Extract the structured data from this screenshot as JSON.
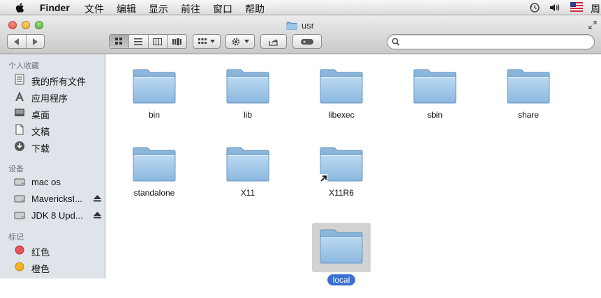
{
  "menubar": {
    "app_name": "Finder",
    "items": [
      "文件",
      "编辑",
      "显示",
      "前往",
      "窗口",
      "帮助"
    ],
    "clock_partial": "周"
  },
  "window": {
    "title": "usr"
  },
  "search": {
    "value": "",
    "placeholder": ""
  },
  "sidebar": {
    "sections": [
      {
        "header": "个人收藏",
        "items": [
          {
            "label": "我的所有文件",
            "icon": "all-files-icon"
          },
          {
            "label": "应用程序",
            "icon": "applications-icon"
          },
          {
            "label": "桌面",
            "icon": "desktop-icon"
          },
          {
            "label": "文稿",
            "icon": "documents-icon"
          },
          {
            "label": "下载",
            "icon": "downloads-icon"
          }
        ]
      },
      {
        "header": "设备",
        "items": [
          {
            "label": "mac os",
            "icon": "disk-icon"
          },
          {
            "label": "MavericksI...",
            "icon": "disk-icon",
            "eject": true
          },
          {
            "label": "JDK 8 Upd...",
            "icon": "disk-icon",
            "eject": true
          }
        ]
      },
      {
        "header": "标记",
        "items": [
          {
            "label": "红色",
            "icon": "tag-red-icon",
            "color": "#e8555a"
          },
          {
            "label": "橙色",
            "icon": "tag-orange-icon",
            "color": "#f5a623"
          }
        ]
      }
    ]
  },
  "folders": [
    {
      "name": "bin"
    },
    {
      "name": "lib"
    },
    {
      "name": "libexec"
    },
    {
      "name": "sbin"
    },
    {
      "name": "share"
    },
    {
      "name": "standalone"
    },
    {
      "name": "X11"
    },
    {
      "name": "X11R6",
      "alias": true
    },
    {
      "name": "local",
      "selected": true
    }
  ],
  "colors": {
    "selection": "#3a70d1",
    "sidebar_bg": "#dfe4ea"
  }
}
